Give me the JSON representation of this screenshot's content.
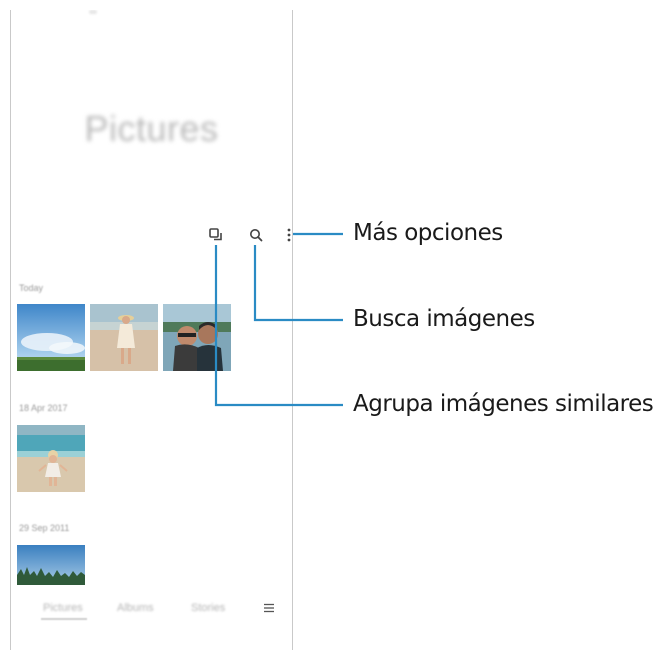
{
  "app": {
    "title": "Pictures",
    "sections": [
      {
        "label": "Today"
      },
      {
        "label": "18 Apr 2017"
      },
      {
        "label": "29 Sep 2011"
      }
    ],
    "bottom_nav": {
      "items": [
        "Pictures",
        "Albums",
        "Stories"
      ],
      "menu_icon": "menu-icon",
      "active": "Pictures"
    },
    "toolbar": {
      "icons": [
        "group-similar-icon",
        "search-icon",
        "more-options-icon"
      ]
    }
  },
  "callouts": {
    "more_options": "Más opciones",
    "search": "Busca imágenes",
    "group_similar": "Agrupa imágenes similares"
  },
  "colors": {
    "callout_line": "#2a8bc4",
    "icon": "#444444"
  }
}
